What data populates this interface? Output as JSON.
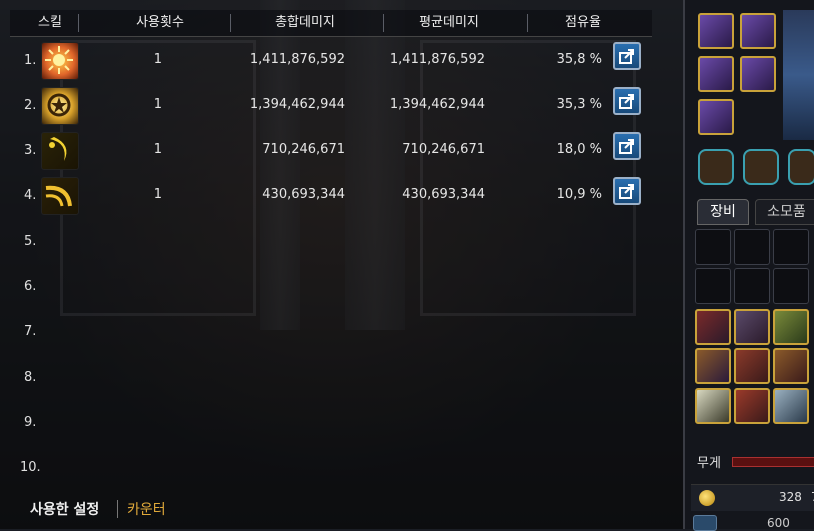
{
  "meter": {
    "headers": {
      "skill": "스킬",
      "uses": "사용횟수",
      "total": "총합데미지",
      "average": "평균데미지",
      "share": "점유율"
    },
    "rows": [
      {
        "rank": "1.",
        "uses": "1",
        "total": "1,411,876,592",
        "average": "1,411,876,592",
        "share": "35,8 %",
        "icon_color": "#e0662a",
        "icon": "sun-burst-icon"
      },
      {
        "rank": "2.",
        "uses": "1",
        "total": "1,394,462,944",
        "average": "1,394,462,944",
        "share": "35,3 %",
        "icon_color": "#d8a12a",
        "icon": "star-burst-icon"
      },
      {
        "rank": "3.",
        "uses": "1",
        "total": "710,246,671",
        "average": "710,246,671",
        "share": "18,0 %",
        "icon_color": "#e3c02a",
        "icon": "crescent-slash-icon"
      },
      {
        "rank": "4.",
        "uses": "1",
        "total": "430,693,344",
        "average": "430,693,344",
        "share": "10,9 %",
        "icon_color": "#e8b830",
        "icon": "wind-slash-icon"
      },
      {
        "rank": "5."
      },
      {
        "rank": "6."
      },
      {
        "rank": "7."
      },
      {
        "rank": "8."
      },
      {
        "rank": "9."
      },
      {
        "rank": "10."
      }
    ]
  },
  "bottom_tabs": {
    "settings": "사용한 설정",
    "counter": "카운터"
  },
  "inventory": {
    "tab_equip": "장비",
    "tab_consumable": "소모품",
    "weight_label": "무게",
    "gold_value": "328",
    "gold_unit": "7",
    "bottom_value": "600"
  },
  "colors": {
    "accent_gold": "#c9a23a",
    "counter_tab": "#e0a93a",
    "share_button": "#2a6fb0"
  }
}
